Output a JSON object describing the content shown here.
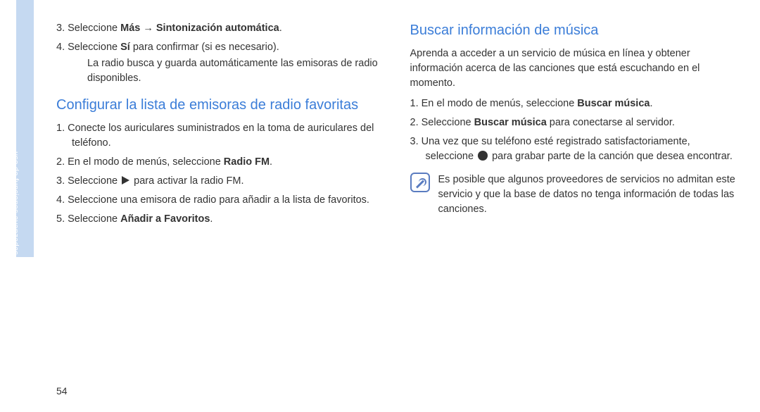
{
  "sideTab": {
    "label": "uso de funciones avanzadas"
  },
  "left": {
    "list1": {
      "items": [
        {
          "pre": "Seleccione ",
          "bold": "Más → Sintonización automática",
          "post": "."
        },
        {
          "pre": "Seleccione ",
          "bold": "Sí",
          "post": " para confirmar (si es necesario).",
          "sub": "La radio busca y guarda automáticamente las emisoras de radio disponibles."
        }
      ]
    },
    "heading2": "Configurar la lista de emisoras de radio favoritas",
    "list2": {
      "items": [
        {
          "text": "Conecte los auriculares suministrados en la toma de auriculares del teléfono."
        },
        {
          "pre": "En el modo de menús, seleccione ",
          "bold": "Radio FM",
          "post": "."
        },
        {
          "pre": "Seleccione ",
          "icon": "play",
          "post": " para activar la radio FM."
        },
        {
          "text": "Seleccione una emisora de radio para añadir a la lista de favoritos."
        },
        {
          "pre": "Seleccione ",
          "bold": "Añadir a Favoritos",
          "post": "."
        }
      ]
    }
  },
  "right": {
    "heading": "Buscar información de música",
    "intro": "Aprenda a acceder a un servicio de música en línea y obtener información acerca de las canciones que está escuchando en el momento.",
    "list": {
      "items": [
        {
          "pre": "En el modo de menús, seleccione ",
          "bold": "Buscar música",
          "post": "."
        },
        {
          "pre": "Seleccione ",
          "bold": "Buscar música",
          "post": " para conectarse al servidor."
        },
        {
          "pre": "Una vez que su teléfono esté registrado satisfactoriamente, seleccione ",
          "icon": "rec",
          "post": " para grabar parte de la canción que desea encontrar."
        }
      ]
    },
    "note": "Es posible que algunos proveedores de servicios no admitan este servicio y que la base de datos no tenga información de todas las canciones."
  },
  "pageNumber": "54"
}
